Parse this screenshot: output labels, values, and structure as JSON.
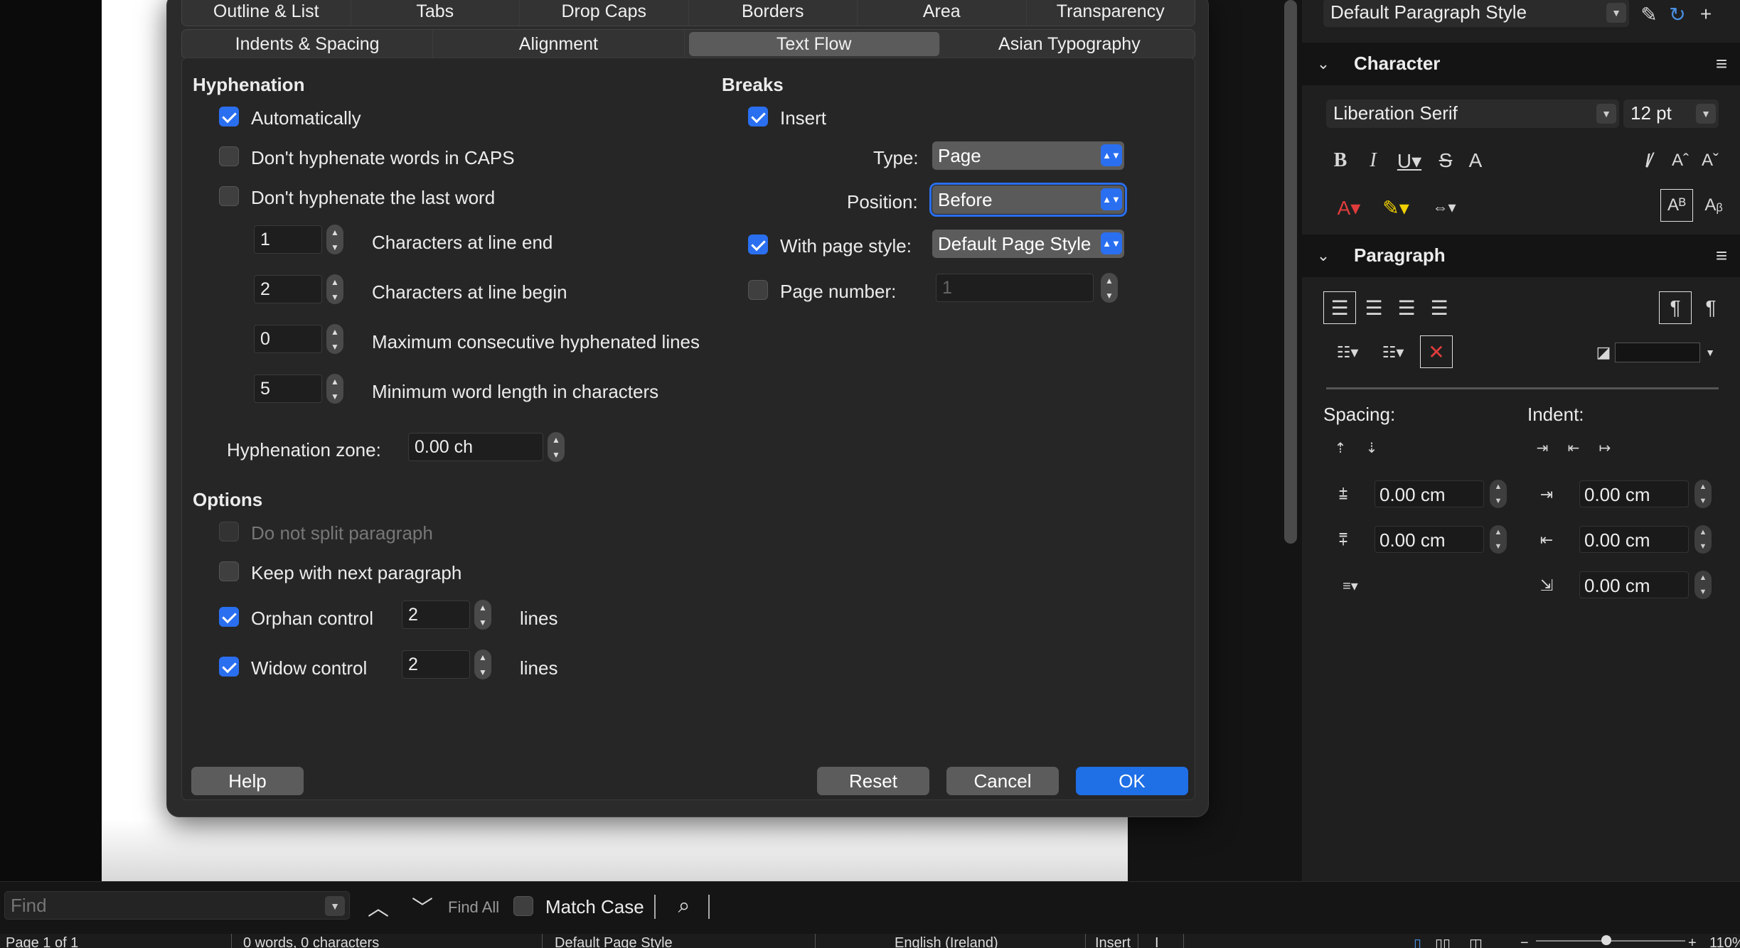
{
  "dialog": {
    "tabs_row1": [
      "Outline & List",
      "Tabs",
      "Drop Caps",
      "Borders",
      "Area",
      "Transparency"
    ],
    "tabs_row2": [
      "Indents & Spacing",
      "Alignment",
      "Text Flow",
      "Asian Typography"
    ],
    "active_tab": "Text Flow",
    "hyphenation": {
      "heading": "Hyphenation",
      "automatically": "Automatically",
      "no_caps": "Don't hyphenate words in CAPS",
      "no_last_word": "Don't hyphenate the last word",
      "chars_line_end_value": "1",
      "chars_line_end_label": "Characters at line end",
      "chars_line_begin_value": "2",
      "chars_line_begin_label": "Characters at line begin",
      "max_consecutive_value": "0",
      "max_consecutive_label": "Maximum consecutive hyphenated lines",
      "min_word_value": "5",
      "min_word_label": "Minimum word length in characters",
      "zone_label": "Hyphenation zone:",
      "zone_value": "0.00 ch"
    },
    "breaks": {
      "heading": "Breaks",
      "insert": "Insert",
      "type_label": "Type:",
      "type_value": "Page",
      "position_label": "Position:",
      "position_value": "Before",
      "with_page_style": "With page style:",
      "page_style_value": "Default Page Style",
      "page_number_label": "Page number:",
      "page_number_value": "1"
    },
    "options": {
      "heading": "Options",
      "do_not_split": "Do not split paragraph",
      "keep_with_next": "Keep with next paragraph",
      "orphan_label": "Orphan control",
      "orphan_value": "2",
      "widow_label": "Widow control",
      "widow_value": "2",
      "lines": "lines"
    },
    "buttons": {
      "help": "Help",
      "reset": "Reset",
      "cancel": "Cancel",
      "ok": "OK"
    }
  },
  "sidebar": {
    "paragraph_style": "Default Paragraph Style",
    "character_heading": "Character",
    "font_name": "Liberation Serif",
    "font_size": "12 pt",
    "paragraph_heading": "Paragraph",
    "spacing_label": "Spacing:",
    "indent_label": "Indent:",
    "above_spacing": "0.00 cm",
    "below_spacing": "0.00 cm",
    "before_indent": "0.00 cm",
    "after_indent": "0.00 cm",
    "first_line_indent": "0.00 cm"
  },
  "findbar": {
    "placeholder": "Find",
    "find_all": "Find All",
    "match_case": "Match Case"
  },
  "statusbar": {
    "page": "Page 1 of 1",
    "words": "0 words, 0 characters",
    "page_style": "Default Page Style",
    "language": "English (Ireland)",
    "mode": "Insert",
    "zoom": "110%"
  }
}
